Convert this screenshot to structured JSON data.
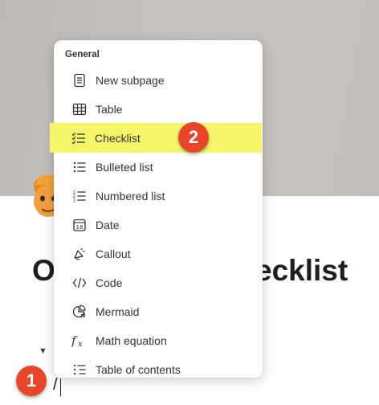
{
  "page": {
    "title_left": "O",
    "title_right": "ecklist",
    "typed_text": "/"
  },
  "menu": {
    "section_header": "General",
    "items": [
      {
        "label": "New subpage",
        "icon": "document-icon"
      },
      {
        "label": "Table",
        "icon": "table-icon"
      },
      {
        "label": "Checklist",
        "icon": "checklist-icon",
        "highlighted": true
      },
      {
        "label": "Bulleted list",
        "icon": "bulleted-list-icon"
      },
      {
        "label": "Numbered list",
        "icon": "numbered-list-icon"
      },
      {
        "label": "Date",
        "icon": "calendar-icon"
      },
      {
        "label": "Callout",
        "icon": "megaphone-icon"
      },
      {
        "label": "Code",
        "icon": "code-icon"
      },
      {
        "label": "Mermaid",
        "icon": "chart-icon"
      },
      {
        "label": "Math equation",
        "icon": "function-icon"
      },
      {
        "label": "Table of contents",
        "icon": "table-of-contents-icon"
      }
    ]
  },
  "annotations": {
    "step1": "1",
    "step2": "2"
  },
  "colors": {
    "highlight": "#f7f66b",
    "badge": "#e8462a"
  }
}
